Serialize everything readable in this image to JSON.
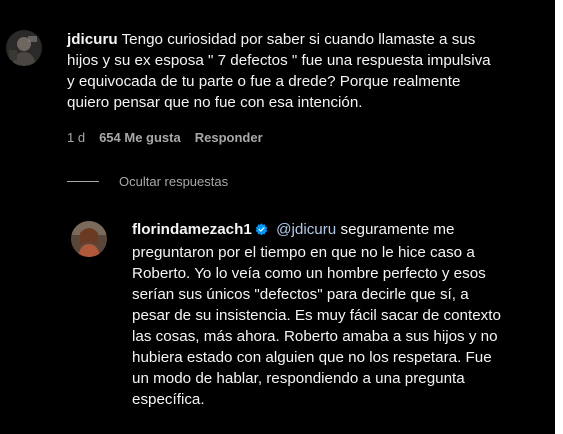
{
  "comment": {
    "username": "jdicuru",
    "lines": [
      "Tengo curiosidad por saber si cuando llamaste a sus",
      "hijos y su ex esposa \" 7 defectos \" fue una respuesta impulsiva",
      "y equivocada de tu parte o fue a drede? Porque realmente",
      "quiero pensar que no fue con esa intención."
    ],
    "time": "1 d",
    "likes": "654 Me gusta",
    "reply_label": "Responder"
  },
  "replies_toggle": {
    "label": "Ocultar respuestas"
  },
  "reply": {
    "username": "florindamezach1",
    "mention": "@jdicuru",
    "lines": [
      "seguramente me",
      "preguntaron por el tiempo en que no le hice caso a",
      "Roberto. Yo lo veía como un hombre perfecto y esos",
      "serían sus únicos \"defectos\" para decirle que sí, a",
      "pesar de su insistencia. Es muy fácil sacar de contexto",
      "las cosas, más ahora. Roberto amaba a sus hijos y no",
      "hubiera estado con alguien que no los respetara. Fue",
      "un modo de hablar, respondiendo a una pregunta",
      "específica."
    ]
  },
  "colors": {
    "background": "#000000",
    "text": "#f5f5f5",
    "muted": "#a8a8a8",
    "mention": "#b4c9e8",
    "verified": "#0095f6"
  }
}
